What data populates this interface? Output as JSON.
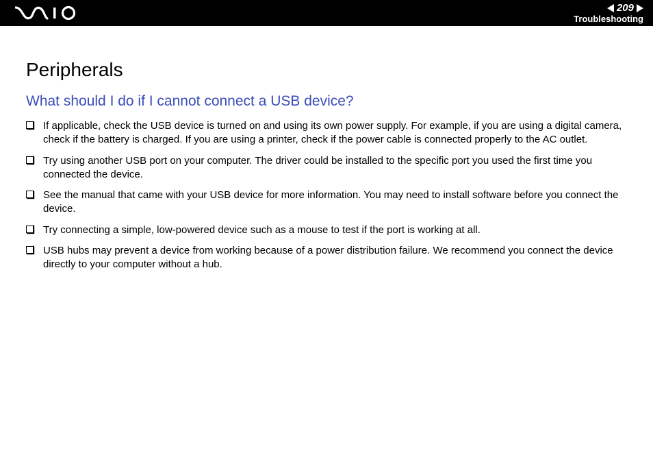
{
  "header": {
    "page_number": "209",
    "section": "Troubleshooting"
  },
  "page": {
    "title": "Peripherals",
    "question": "What should I do if I cannot connect a USB device?",
    "items": [
      "If applicable, check the USB device is turned on and using its own power supply. For example, if you are using a digital camera, check if the battery is charged. If you are using a printer, check if the power cable is connected properly to the AC outlet.",
      "Try using another USB port on your computer. The driver could be installed to the specific port you used the first time you connected the device.",
      "See the manual that came with your USB device for more information. You may need to install software before you connect the device.",
      "Try connecting a simple, low-powered device such as a mouse to test if the port is working at all.",
      "USB hubs may prevent a device from working because of a power distribution failure. We recommend you connect the device directly to your computer without a hub."
    ]
  }
}
